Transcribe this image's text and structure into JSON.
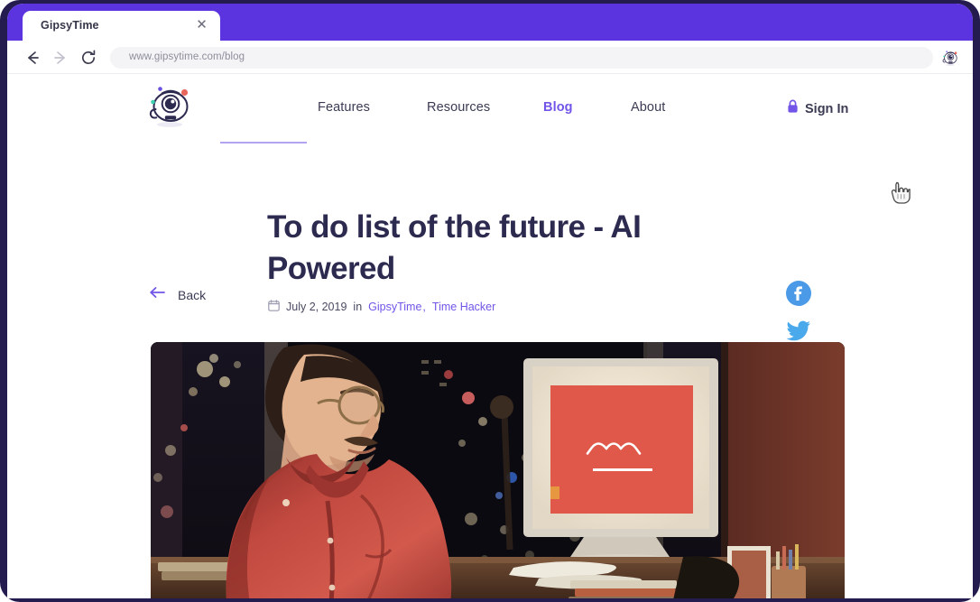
{
  "browser": {
    "tab_title": "GipsyTime",
    "close_label": "✕",
    "url": "www.gipsytime.com/blog",
    "back_icon": "arrow-left-icon",
    "forward_icon": "arrow-right-icon",
    "reload_icon": "reload-icon",
    "profile_icon": "gipsytime-avatar-icon",
    "chrome_color": "#5b34e0"
  },
  "site": {
    "logo_alt": "GipsyTime logo",
    "nav": [
      {
        "label": "Features",
        "active": false
      },
      {
        "label": "Resources",
        "active": false
      },
      {
        "label": "Blog",
        "active": true
      },
      {
        "label": "About",
        "active": false
      }
    ],
    "signin": {
      "label": "Sign In",
      "icon": "lock-icon"
    },
    "accent_color": "#7255e8",
    "heading_color": "#2d2a50"
  },
  "article": {
    "back_label": "Back",
    "back_icon": "arrow-left-icon",
    "title": "To do list of the future - AI Powered",
    "meta": {
      "calendar_icon": "calendar-icon",
      "date": "July 2, 2019",
      "connector": "in",
      "categories": [
        {
          "label": "GipsyTime"
        },
        {
          "label": "Time Hacker"
        }
      ],
      "separator": ","
    },
    "hero_alt": "Man in red shirt at desk in front of glowing monitor with city skyline at night"
  },
  "social": [
    {
      "name": "facebook",
      "glyph": "f",
      "color": "#4a9ae8"
    },
    {
      "name": "twitter",
      "glyph": "bird",
      "color": "#4aa9ea"
    }
  ],
  "cursor": {
    "type": "pointer-hand-cursor"
  }
}
